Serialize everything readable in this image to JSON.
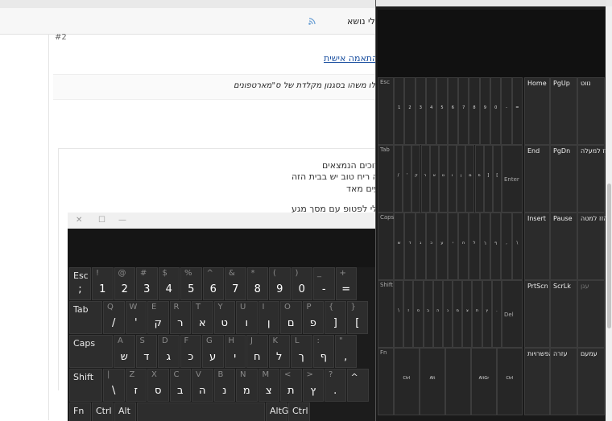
{
  "toolbar": {
    "thread_tools": "כלי נושא"
  },
  "post": {
    "number": "#2",
    "signature_link": "התאמה אישית:",
    "signature_text": "ריחב, אפילו משהו בסגנון מקלדת של ס\"מארטפונים",
    "quote_lines": [
      "ברוכים הנמצאים",
      "איזה ריח טוב יש בבית הזה",
      "עים מאד",
      "ש לי לפטופ עם מסך מגע"
    ]
  },
  "small_keyboard": {
    "rows": [
      [
        {
          "top": "~",
          "main": ";",
          "label": "Esc",
          "w": 28
        },
        {
          "top": "!",
          "main": "1"
        },
        {
          "top": "@",
          "main": "2"
        },
        {
          "top": "#",
          "main": "3"
        },
        {
          "top": "$",
          "main": "4"
        },
        {
          "top": "%",
          "main": "5"
        },
        {
          "top": "^",
          "main": "6"
        },
        {
          "top": "&",
          "main": "7"
        },
        {
          "top": "*",
          "main": "8"
        },
        {
          "top": "(",
          "main": "9"
        },
        {
          "top": ")",
          "main": "0"
        },
        {
          "top": "_",
          "main": "-"
        },
        {
          "top": "+",
          "main": "="
        }
      ],
      [
        {
          "label": "Tab",
          "w": 42
        },
        {
          "top": "Q",
          "main": "/"
        },
        {
          "top": "W",
          "main": "'"
        },
        {
          "top": "E",
          "main": "ק"
        },
        {
          "top": "R",
          "main": "ר"
        },
        {
          "top": "T",
          "main": "א"
        },
        {
          "top": "Y",
          "main": "ט"
        },
        {
          "top": "U",
          "main": "ו"
        },
        {
          "top": "I",
          "main": "ן"
        },
        {
          "top": "O",
          "main": "ם"
        },
        {
          "top": "P",
          "main": "פ"
        },
        {
          "top": "{",
          "main": "]"
        },
        {
          "top": "}",
          "main": "["
        }
      ],
      [
        {
          "label": "Caps",
          "w": 55
        },
        {
          "top": "A",
          "main": "ש"
        },
        {
          "top": "S",
          "main": "ד"
        },
        {
          "top": "D",
          "main": "ג"
        },
        {
          "top": "F",
          "main": "כ"
        },
        {
          "top": "G",
          "main": "ע"
        },
        {
          "top": "H",
          "main": "י"
        },
        {
          "top": "J",
          "main": "ח"
        },
        {
          "top": "K",
          "main": "ל"
        },
        {
          "top": "L",
          "main": "ך"
        },
        {
          "top": ":",
          "main": "ף"
        },
        {
          "top": "\"",
          "main": ","
        }
      ],
      [
        {
          "label": "Shift",
          "w": 42
        },
        {
          "top": "|",
          "main": "\\"
        },
        {
          "top": "Z",
          "main": "ז"
        },
        {
          "top": "X",
          "main": "ס"
        },
        {
          "top": "C",
          "main": "ב"
        },
        {
          "top": "V",
          "main": "ה"
        },
        {
          "top": "B",
          "main": "נ"
        },
        {
          "top": "N",
          "main": "מ"
        },
        {
          "top": "M",
          "main": "צ"
        },
        {
          "top": "<",
          "main": "ת"
        },
        {
          "top": ">",
          "main": "ץ"
        },
        {
          "top": "?",
          "main": "."
        },
        {
          "label": "^",
          "w": 28
        }
      ],
      [
        {
          "label": "Fn",
          "w": 28
        },
        {
          "label": "Ctrl",
          "w": 28
        },
        {
          "label": "Alt",
          "w": 28
        },
        {
          "label": "",
          "w": 160
        },
        {
          "label": "AltGr",
          "w": 28
        },
        {
          "label": "Ctrl",
          "w": 28
        }
      ]
    ]
  },
  "big_keyboard": {
    "letter_rows": [
      {
        "label": "Esc",
        "keys": [
          "1",
          "2",
          "3",
          "4",
          "5",
          "6",
          "7",
          "8",
          "9",
          "0",
          "-",
          "="
        ]
      },
      {
        "label": "Tab",
        "keys": [
          "/",
          "'",
          "ק",
          "ר",
          "א",
          "ט",
          "ו",
          "ן",
          "ם",
          "פ",
          "]",
          "["
        ],
        "end": "Enter"
      },
      {
        "label": "Caps",
        "keys": [
          "ש",
          "ד",
          "ג",
          "כ",
          "ע",
          "י",
          "ח",
          "ל",
          "ך",
          "ף",
          ",",
          "\\"
        ]
      },
      {
        "label": "Shift",
        "keys": [
          "\\",
          "ז",
          "ס",
          "ב",
          "ה",
          "נ",
          "מ",
          "צ",
          "ת",
          "ץ",
          "."
        ],
        "end": "Del"
      },
      {
        "label": "Fn",
        "keys": [
          "Ctrl",
          "Alt",
          "",
          "AltGr",
          "Ctrl"
        ]
      }
    ],
    "nav_keys": [
      [
        "Home",
        "PgUp",
        "נווט"
      ],
      [
        "End",
        "PgDn",
        "הזז למעלה"
      ],
      [
        "Insert",
        "Pause",
        "הזז למטה"
      ],
      [
        "PrtScn",
        "ScrLk",
        "עגן"
      ],
      [
        "אפשרויות",
        "עזרה",
        "עמעם"
      ]
    ]
  }
}
